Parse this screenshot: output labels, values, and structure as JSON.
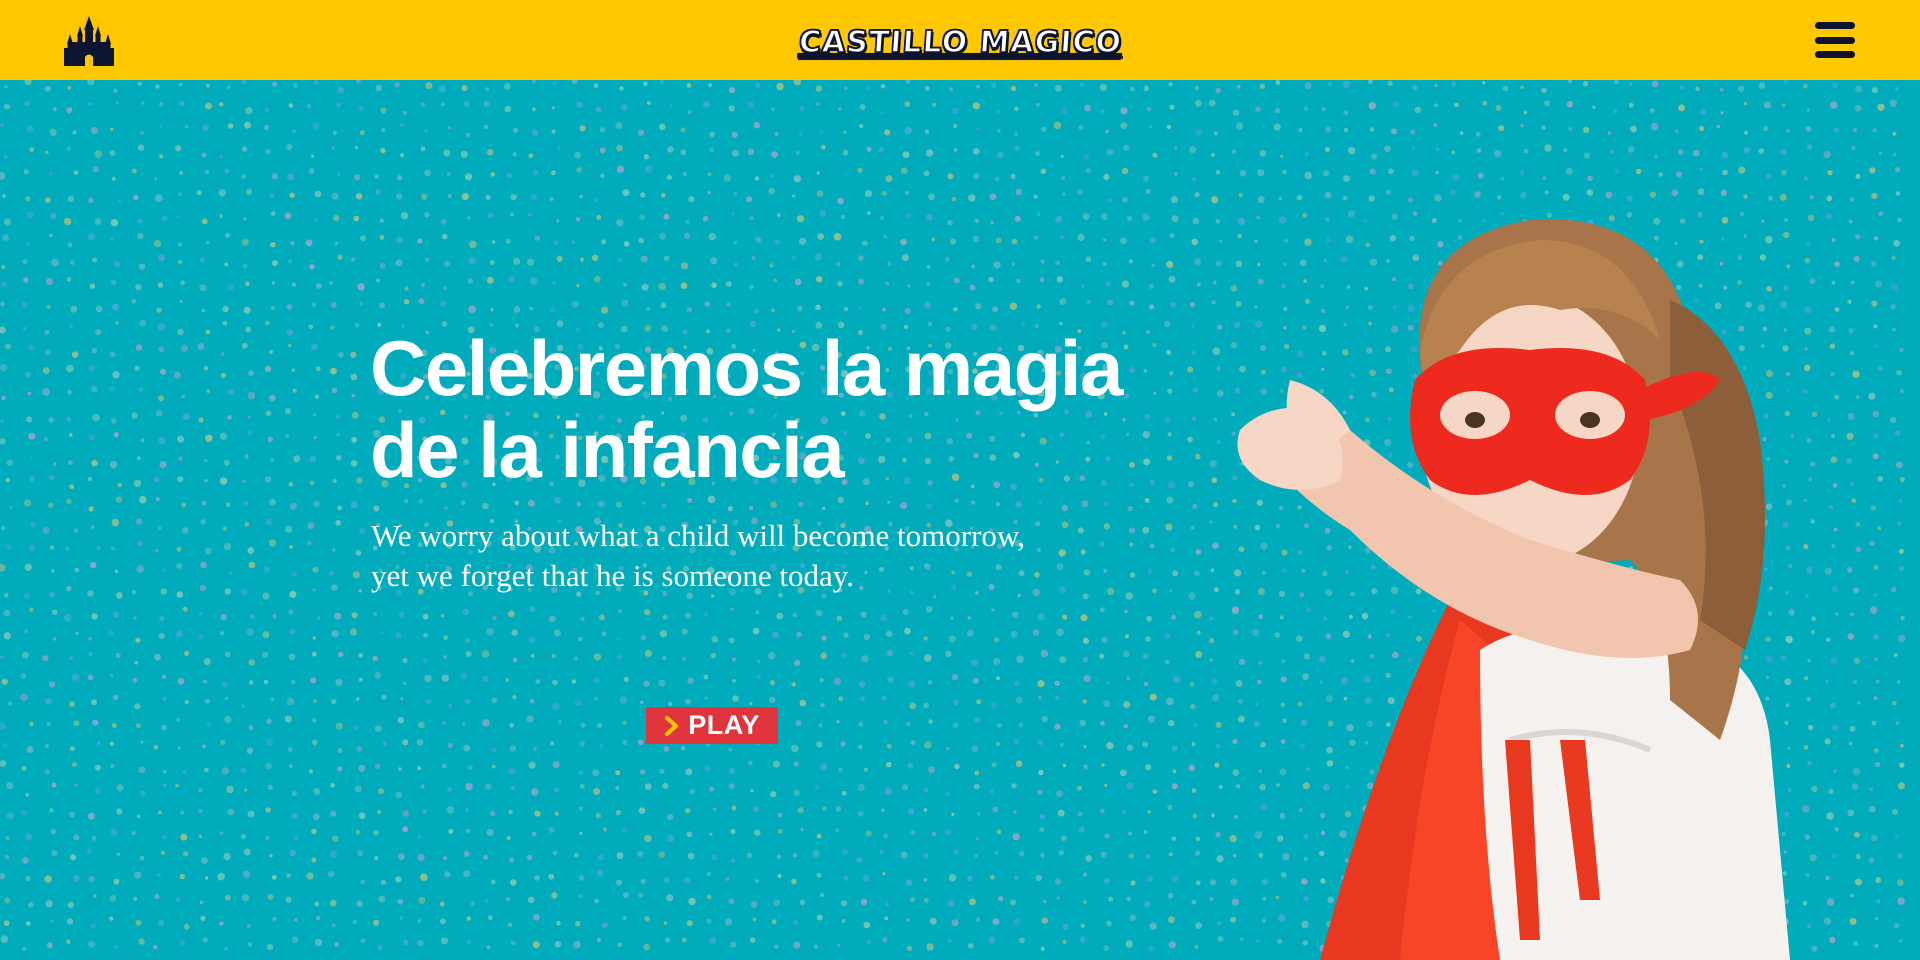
{
  "header": {
    "brand": "CASTILLO MAGICO",
    "logo_icon": "castle-icon",
    "menu_icon": "hamburger-menu-icon"
  },
  "hero": {
    "title_line1": "Celebremos la magia",
    "title_line2": "de la infancia",
    "subtitle_line1": "We worry about what a child will become tomorrow,",
    "subtitle_line2": "yet we forget that he is someone today.",
    "play_label": "PLAY",
    "play_icon": "chevron-right-icon",
    "image": "girl-superhero-photo"
  },
  "colors": {
    "header_bg": "#ffc800",
    "hero_bg": "#00abbc",
    "button_bg": "#e0353d",
    "icon_dark": "#0d1430",
    "chevron": "#ffc800"
  }
}
